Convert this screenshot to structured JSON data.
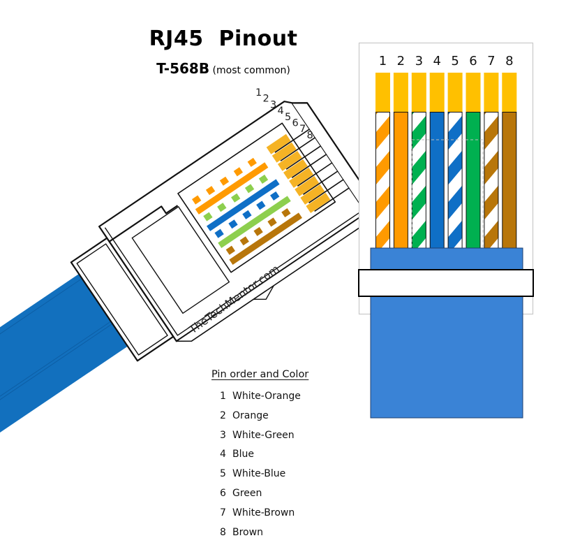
{
  "header": {
    "title": "RJ45  Pinout",
    "standard": "T-568B",
    "standard_note": "(most common)"
  },
  "watermark": "TheTechMentor.com",
  "legend": {
    "title": "Pin order and Color",
    "items": [
      {
        "pin": "1",
        "label": "White-Orange"
      },
      {
        "pin": "2",
        "label": "Orange"
      },
      {
        "pin": "3",
        "label": "White-Green"
      },
      {
        "pin": "4",
        "label": "Blue"
      },
      {
        "pin": "5",
        "label": "White-Blue"
      },
      {
        "pin": "6",
        "label": "Green"
      },
      {
        "pin": "7",
        "label": "White-Brown"
      },
      {
        "pin": "8",
        "label": "Brown"
      }
    ]
  },
  "colors": {
    "contact_gold": "#FFC000",
    "plug_wire_gold": "#F5B325",
    "cable_blue_plug": "#1270BE",
    "jacket_blue": "#3A83D6",
    "orange": "#FF9A00",
    "green": "#00B050",
    "green_plug": "#8DCF4E",
    "blue": "#0F6FC6",
    "brown": "#B8760A",
    "outline": "#111111",
    "frame": "#C8C8C8"
  },
  "pins": [
    {
      "number": "1",
      "color": "orange",
      "plug_color": "orange",
      "striped": true
    },
    {
      "number": "2",
      "color": "orange",
      "plug_color": "orange",
      "striped": false
    },
    {
      "number": "3",
      "color": "green",
      "plug_color": "green_plug",
      "striped": true
    },
    {
      "number": "4",
      "color": "blue",
      "plug_color": "blue",
      "striped": false
    },
    {
      "number": "5",
      "color": "blue",
      "plug_color": "blue",
      "striped": true
    },
    {
      "number": "6",
      "color": "green",
      "plug_color": "green_plug",
      "striped": false
    },
    {
      "number": "7",
      "color": "brown",
      "plug_color": "brown",
      "striped": true
    },
    {
      "number": "8",
      "color": "brown",
      "plug_color": "brown",
      "striped": false
    }
  ]
}
